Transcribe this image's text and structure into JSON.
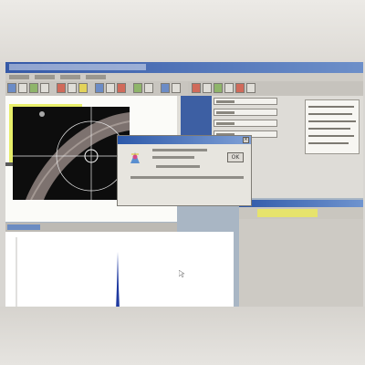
{
  "dialog": {
    "ok_label": "OK",
    "close_glyph": "×"
  },
  "icons": [
    "monitor-bezel",
    "program-logo-icon",
    "mouse-cursor-icon",
    "close-icon"
  ],
  "colors": {
    "spectrum_highlight": "#e7ee6a",
    "title_bar": "#3559a7",
    "main_peak": "#1f3aa0",
    "image_background": "#0d0d0d"
  }
}
